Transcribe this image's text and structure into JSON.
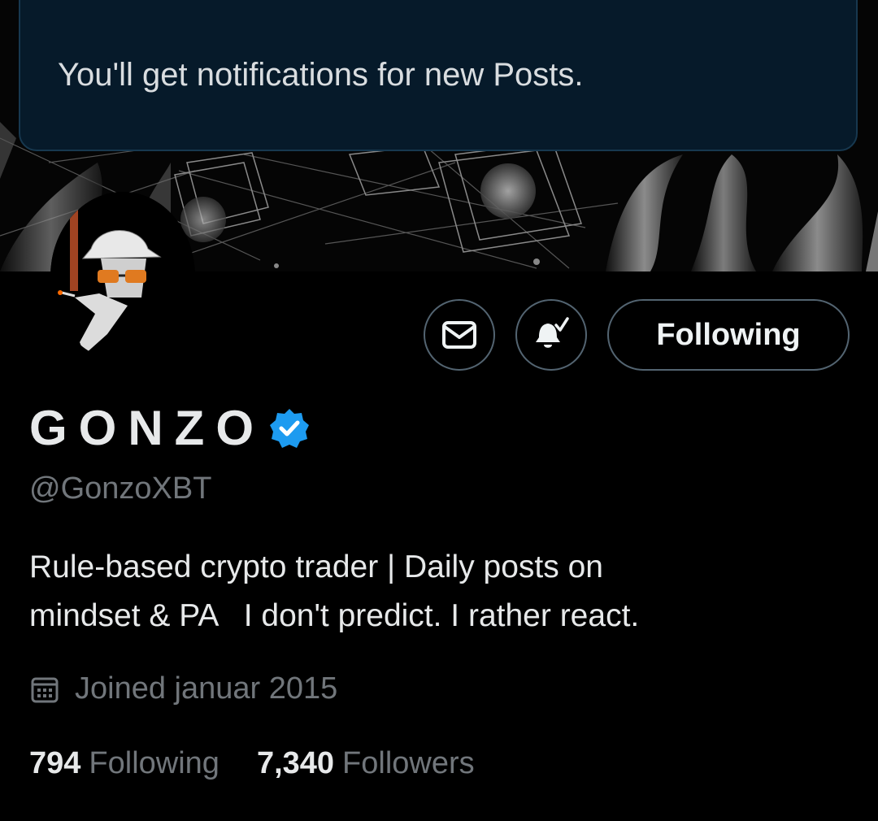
{
  "toast": {
    "message": "You'll get notifications for new Posts."
  },
  "profile": {
    "display_name": "GONZO",
    "verified_badge": "verified-badge-icon",
    "handle": "@GonzoXBT",
    "bio": "Rule-based crypto trader | Daily posts on\nmindset & PA   I don't predict. I rather react.",
    "joined": "Joined januar 2015",
    "following_count": "794",
    "following_label": "Following",
    "followers_count": "7,340",
    "followers_label": "Followers"
  },
  "actions": {
    "message_icon": "mail-icon",
    "notify_icon": "bell-check-icon",
    "follow_label": "Following"
  },
  "colors": {
    "background": "#000000",
    "toast_bg": "#061a2a",
    "text_primary": "#e7e9ea",
    "text_secondary": "#71767b",
    "border": "#536471",
    "verified": "#1d9bf0"
  }
}
